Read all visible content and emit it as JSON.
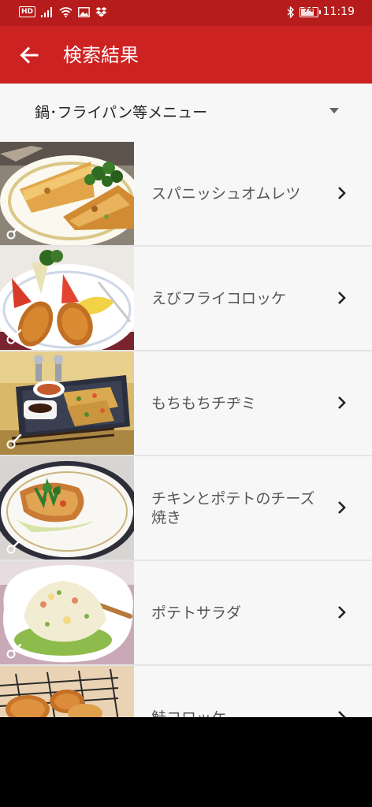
{
  "status_bar": {
    "hd": "HD",
    "battery": "74",
    "time": "11:19"
  },
  "app_bar": {
    "title": "検索結果"
  },
  "category": {
    "selected": "鍋･フライパン等メニュー"
  },
  "recipes": [
    {
      "title": "スパニッシュオムレツ"
    },
    {
      "title": "えびフライコロッケ"
    },
    {
      "title": "もちもちチヂミ"
    },
    {
      "title": "チキンとポテトのチーズ焼き"
    },
    {
      "title": "ポテトサラダ"
    },
    {
      "title": "鮭コロッケ"
    }
  ],
  "colors": {
    "status_bar": "#b71c1c",
    "app_bar": "#cc2222",
    "background": "#f7f7f7",
    "divider": "#e4e4e4",
    "title_text": "#555555"
  },
  "icons": {
    "back": "arrow-left-icon",
    "dropdown": "caret-down-icon",
    "row_chevron": "chevron-right-icon",
    "photo_tag": "cooking-tool-icon"
  }
}
